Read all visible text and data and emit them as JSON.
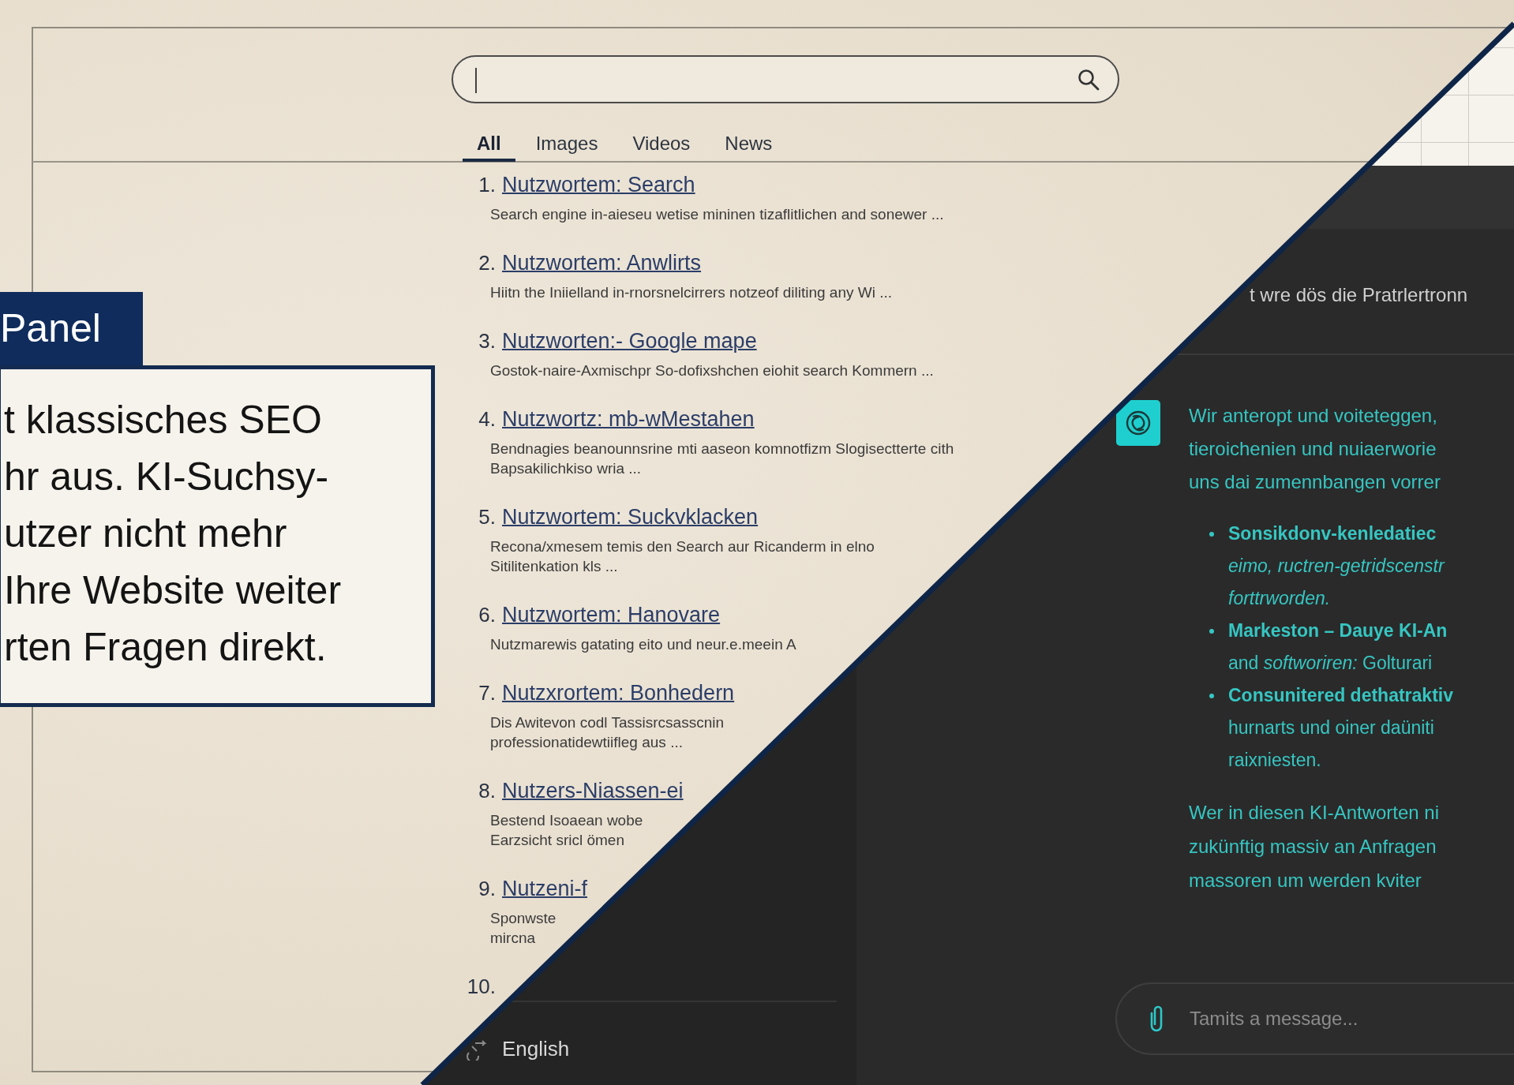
{
  "search": {
    "tabs": [
      {
        "label": "All",
        "selected": true
      },
      {
        "label": "Images",
        "selected": false
      },
      {
        "label": "Videos",
        "selected": false
      },
      {
        "label": "News",
        "selected": false
      }
    ]
  },
  "results": [
    {
      "number": "1.",
      "title": "Nutzwortem: Search",
      "snippet": [
        "Search engine in-aieseu wetise mininen tizaflitlichen and sonewer ..."
      ]
    },
    {
      "number": "2.",
      "title": "Nutzwortem: Anwlirts",
      "snippet": [
        "Hiitn the Iniielland in-rnorsnelcirrers notzeof diliting any Wi ..."
      ]
    },
    {
      "number": "3.",
      "title": "Nutzworten:- Google mape",
      "snippet": [
        "Gostok-naire-Axmischpr So-dofixshchen eiohit search Kommern ..."
      ]
    },
    {
      "number": "4.",
      "title": "Nutzwortz: mb-wMestahen",
      "snippet": [
        "Bendnagies beanounnsrine mti aaseon komnotfizm Slogisectterte cith",
        "Bapsakilichkiso wria ..."
      ]
    },
    {
      "number": "5.",
      "title": "Nutzwortem: Suckvklacken",
      "snippet": [
        "Recona/xmesem temis den Search aur Ricanderm in elno",
        "Sitilitenkation kls ..."
      ]
    },
    {
      "number": "6.",
      "title": "Nutzwortem: Hanovare",
      "snippet": [
        "Nutzmarewis gatating eito und neur.e.meein A"
      ]
    },
    {
      "number": "7.",
      "title": "Nutzxrortem: Bonhedern",
      "snippet": [
        "Dis Awitevon codl Tassisrcsasscnin",
        "professionatidewtiifleg aus ..."
      ]
    },
    {
      "number": "8.",
      "title": "Nutzers-Niassen-ei",
      "snippet": [
        "Bestend Isoaean wobe",
        "Earzsicht sricl ömen"
      ]
    },
    {
      "number": "9.",
      "title": "Nutzeni-f",
      "snippet": [
        "Sponwste",
        "mircna"
      ]
    },
    {
      "number": "10."
    }
  ],
  "callout": {
    "label": "Panel",
    "lines": [
      "t klassisches SEO",
      "hr aus. KI-Suchsy-",
      "utzer nicht mehr",
      "Ihre Website weiter",
      "rten Fragen direkt."
    ]
  },
  "language": "English",
  "chat": {
    "user_message": "t wre dös die Pratrlertronn",
    "answer_intro": [
      "Wir anteropt und voiteteggen,",
      "tieroichenien und nuiaerworie",
      "uns dai zumennbangen vorrer"
    ],
    "bullets": [
      {
        "lines": [
          "**Sonsikdonv-kenledatiec**",
          "*eimo, ructren-getridscenstr*",
          "*forttrworden.*"
        ]
      },
      {
        "lines": [
          "**Markeston – Dauye KI-An**",
          "and *softworiren:* Golturari"
        ]
      },
      {
        "lines": [
          "**Consunitered dethatraktiv**",
          "hurnarts und oiner daüniti",
          "raixniesten."
        ]
      }
    ],
    "closing": [
      "Wer in diesen KI-Antworten ni",
      "zukünftig massiv an Anfragen",
      "massoren um werden kviter"
    ],
    "input": {
      "placeholder": "Tamits a message..."
    }
  }
}
